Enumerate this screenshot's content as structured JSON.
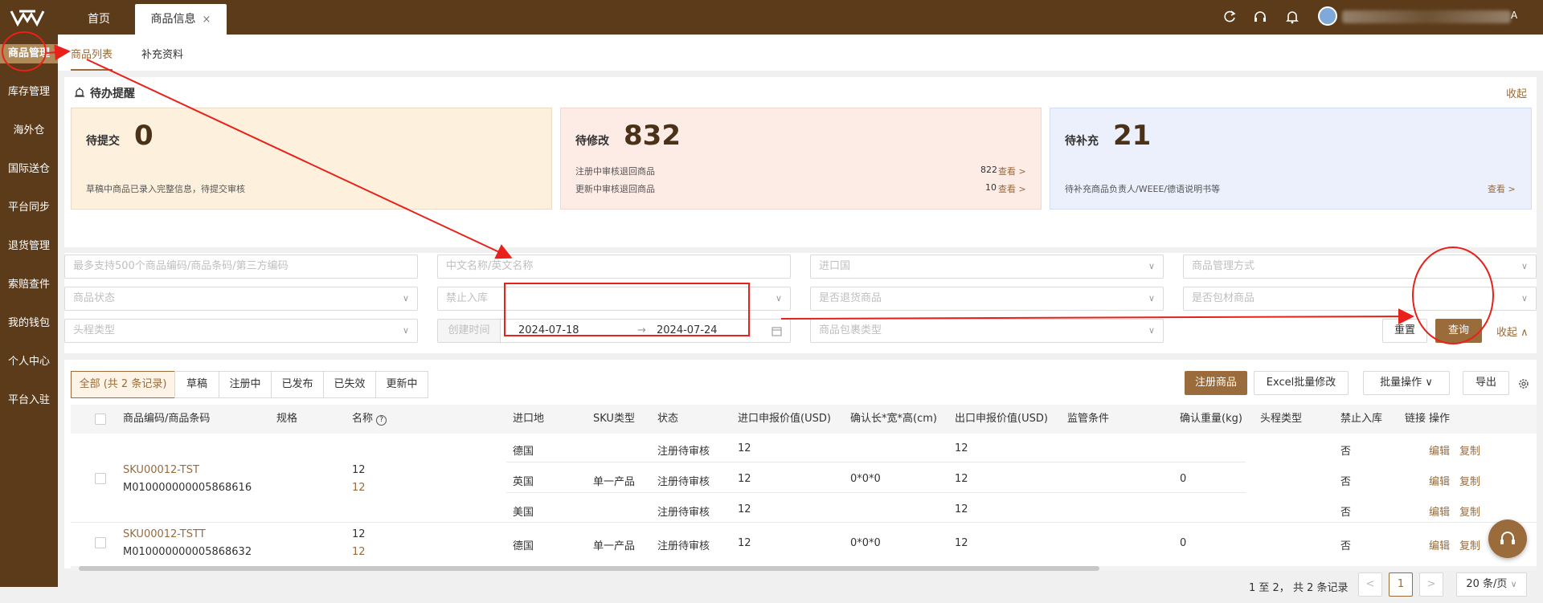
{
  "header": {
    "home_tab": "首页",
    "active_tab": "商品信息",
    "close_glyph": "×",
    "user_suffix": "A"
  },
  "sidebar": {
    "items": [
      "商品管理",
      "库存管理",
      "海外仓",
      "国际送仓",
      "平台同步",
      "退货管理",
      "索赔查件",
      "我的钱包",
      "个人中心",
      "平台入驻"
    ]
  },
  "subtabs": [
    "商品列表",
    "补充资料"
  ],
  "reminder": {
    "title": "待办提醒",
    "collapse": "收起",
    "cards": [
      {
        "label": "待提交",
        "count": "0",
        "lines": [
          {
            "text": "草稿中商品已录入完整信息，待提交审核",
            "count": "",
            "link": ""
          }
        ]
      },
      {
        "label": "待修改",
        "count": "832",
        "lines": [
          {
            "text": "注册中审核退回商品",
            "count": "822",
            "link": "查看 >"
          },
          {
            "text": "更新中审核退回商品",
            "count": "10",
            "link": "查看 >"
          }
        ]
      },
      {
        "label": "待补充",
        "count": "21",
        "lines": [
          {
            "text": "待补充商品负责人/WEEE/德语说明书等",
            "count": "",
            "link": "查看 >"
          }
        ]
      }
    ]
  },
  "filters": {
    "code_placeholder": "最多支持500个商品编码/商品条码/第三方编码",
    "name_placeholder": "中文名称/英文名称",
    "import_country": "进口国",
    "mgmt_method": "商品管理方式",
    "status": "商品状态",
    "forbid": "禁止入库",
    "returned": "是否退货商品",
    "packaging": "是否包材商品",
    "leg_type": "头程类型",
    "created_label": "创建时间",
    "date_start": "2024-07-18",
    "date_arrow": "→",
    "date_end": "2024-07-24",
    "pack_type": "商品包裹类型",
    "reset": "重置",
    "query": "查询",
    "collapse": "收起"
  },
  "status_tabs": [
    "全部 (共 2 条记录)",
    "草稿",
    "注册中",
    "已发布",
    "已失效",
    "更新中"
  ],
  "actions": {
    "register": "注册商品",
    "excel": "Excel批量修改",
    "batch": "批量操作",
    "export": "导出"
  },
  "table": {
    "headers": [
      "商品编码/商品条码",
      "规格",
      "名称",
      "进口地",
      "SKU类型",
      "状态",
      "进口申报价值(USD)",
      "确认长*宽*高(cm)",
      "出口申报价值(USD)",
      "监管条件",
      "确认重量(kg)",
      "头程类型",
      "禁止入库",
      "链接",
      "操作"
    ],
    "rows": [
      {
        "sku": "SKU00012-TST",
        "barcode": "M010000000005868616",
        "name": "12",
        "name2": "12",
        "sku_type": "单一产品",
        "dims": "0*0*0",
        "weight": "0",
        "subrows": [
          {
            "country": "德国",
            "status": "注册待审核",
            "import_val": "12",
            "export_val": "12",
            "forbid": "否"
          },
          {
            "country": "英国",
            "status": "注册待审核",
            "import_val": "12",
            "export_val": "12",
            "forbid": "否"
          },
          {
            "country": "美国",
            "status": "注册待审核",
            "import_val": "12",
            "export_val": "12",
            "forbid": "否"
          }
        ]
      },
      {
        "sku": "SKU00012-TSTT",
        "barcode": "M010000000005868632",
        "name": "12",
        "name2": "12",
        "sku_type": "单一产品",
        "dims": "0*0*0",
        "weight": "0",
        "subrows": [
          {
            "country": "德国",
            "status": "注册待审核",
            "import_val": "12",
            "export_val": "12",
            "forbid": "否"
          }
        ]
      }
    ],
    "op_edit": "编辑",
    "op_copy": "复制"
  },
  "pagination": {
    "summary": "1 至 2， 共 2 条记录",
    "prev": "<",
    "page": "1",
    "next": ">",
    "per_page": "20 条/页"
  },
  "colors": {
    "brand": "#5b3b19",
    "accent": "#9a6b3b",
    "annotation": "#e8211a"
  }
}
